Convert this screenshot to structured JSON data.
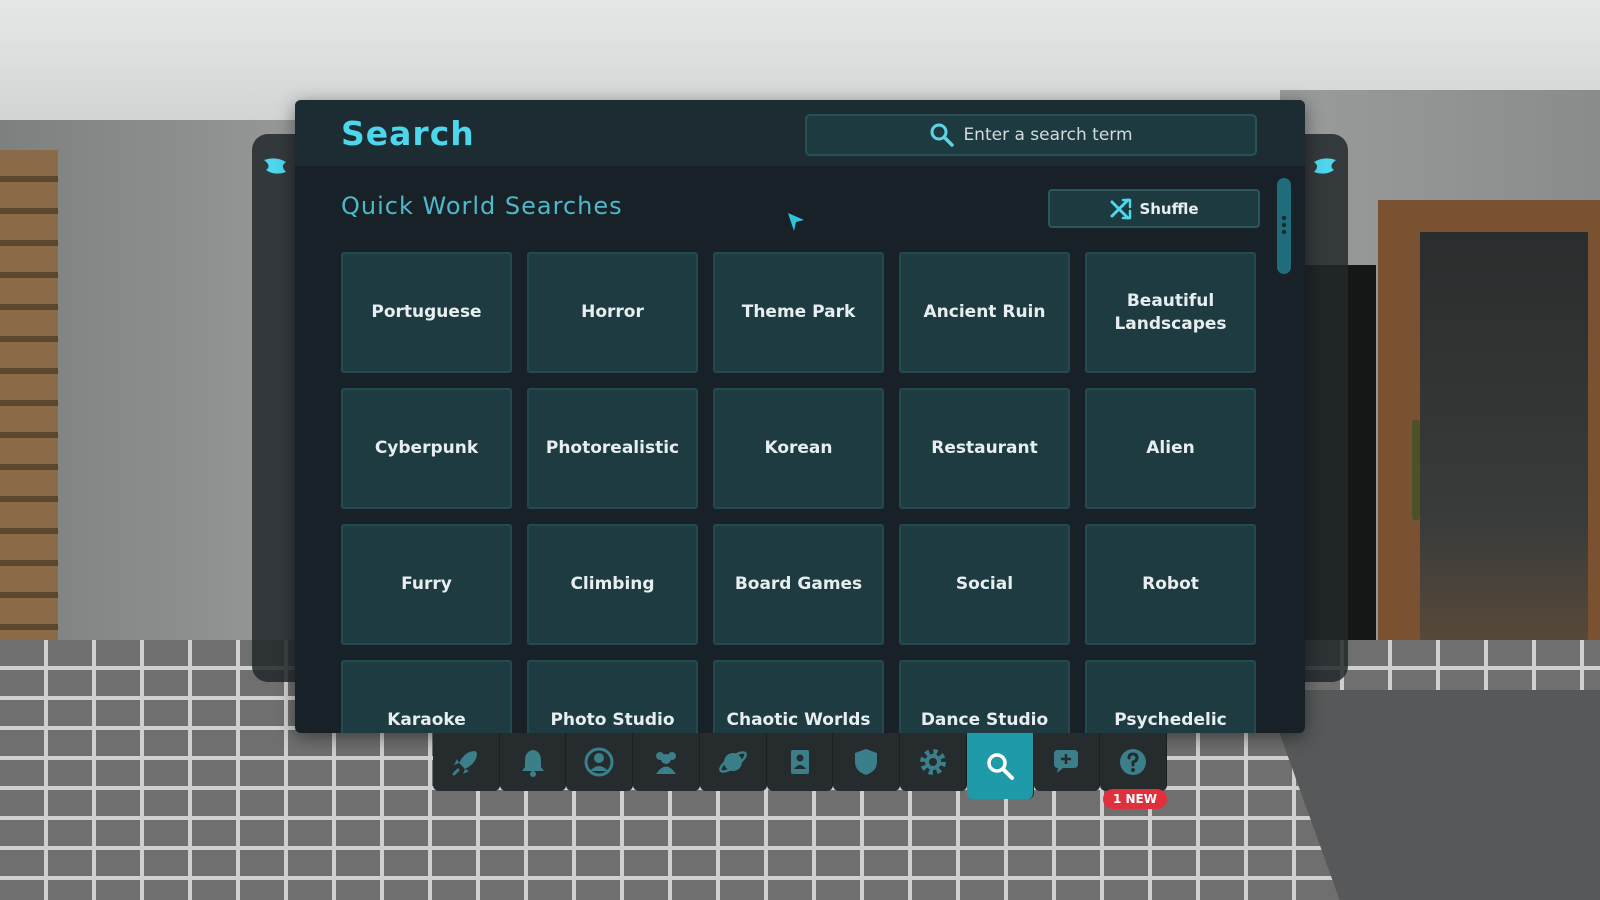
{
  "colors": {
    "accent": "#4ed6ec",
    "panel_bg": "#172127",
    "tile_bg": "#1d3b40",
    "dock_active": "#1e9aa8",
    "badge": "#e0303e"
  },
  "header": {
    "title": "Search",
    "search_placeholder": "Enter a search term",
    "search_icon": "search-icon"
  },
  "quick_searches": {
    "title": "Quick World Searches",
    "shuffle_label": "Shuffle",
    "tiles": [
      "Portuguese",
      "Horror",
      "Theme Park",
      "Ancient Ruin",
      "Beautiful Landscapes",
      "Cyberpunk",
      "Photorealistic",
      "Korean",
      "Restaurant",
      "Alien",
      "Furry",
      "Climbing",
      "Board Games",
      "Social",
      "Robot",
      "Karaoke",
      "Photo Studio",
      "Chaotic Worlds",
      "Dance Studio",
      "Psychedelic"
    ]
  },
  "dock": {
    "items": [
      {
        "icon": "rocket-icon",
        "active": false
      },
      {
        "icon": "bell-icon",
        "active": false
      },
      {
        "icon": "profile-icon",
        "active": false
      },
      {
        "icon": "friends-icon",
        "active": false
      },
      {
        "icon": "worlds-icon",
        "active": false
      },
      {
        "icon": "avatars-icon",
        "active": false
      },
      {
        "icon": "safety-shield-icon",
        "active": false
      },
      {
        "icon": "settings-gear-icon",
        "active": false
      },
      {
        "icon": "search-icon",
        "active": true
      },
      {
        "icon": "chat-icon",
        "active": false
      },
      {
        "icon": "help-icon",
        "active": false
      }
    ],
    "help_badge": "1 NEW"
  }
}
